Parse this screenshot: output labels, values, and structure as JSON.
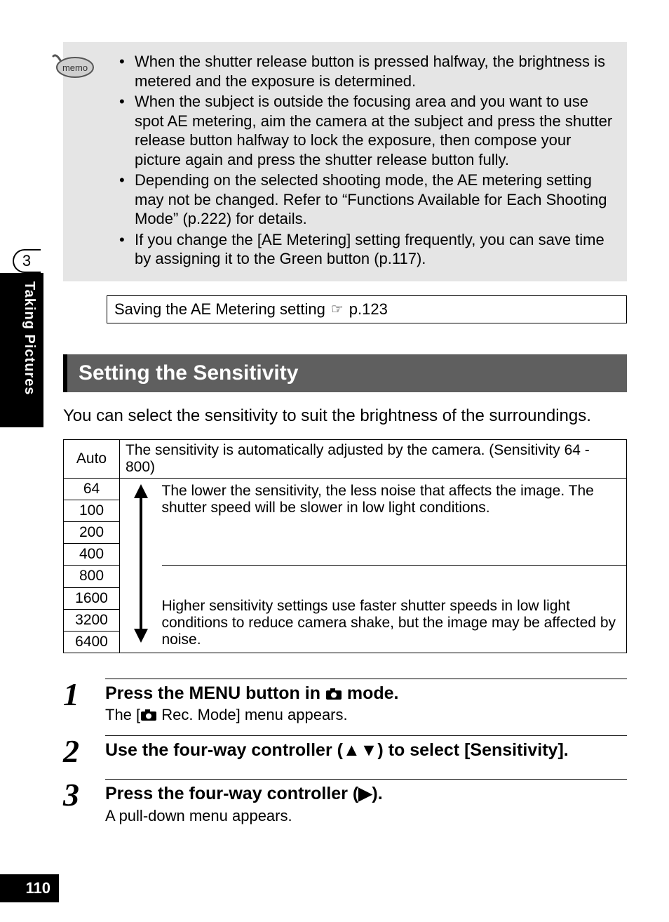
{
  "side_tab": {
    "chapter_number": "3",
    "chapter_title": "Taking Pictures"
  },
  "memo": {
    "label": "memo",
    "bullets": [
      "When the shutter release button is pressed halfway, the brightness is metered and the exposure is determined.",
      "When the subject is outside the focusing area and you want to use spot AE metering, aim the camera at the subject and press the shutter release button halfway to lock the exposure, then compose your picture again and press the shutter release button fully.",
      "Depending on the selected shooting mode, the AE metering setting may not be changed. Refer to “Functions Available for Each Shooting Mode” (p.222) for details.",
      "If you change the [AE Metering] setting frequently, you can save time by assigning it to the Green button (p.117)."
    ]
  },
  "link_box": {
    "text": "Saving the AE Metering setting",
    "page_ref": "p.123"
  },
  "section": {
    "heading": "Setting the Sensitivity",
    "intro": "You can select the sensitivity to suit the brightness of the surroundings."
  },
  "sensitivity_table": {
    "rows": [
      {
        "label": "Auto",
        "desc": "The sensitivity is automatically adjusted by the camera. (Sensitivity 64 - 800)"
      },
      {
        "label": "64"
      },
      {
        "label": "100"
      },
      {
        "label": "200"
      },
      {
        "label": "400"
      },
      {
        "label": "800"
      },
      {
        "label": "1600"
      },
      {
        "label": "3200"
      },
      {
        "label": "6400"
      }
    ],
    "low_desc": "The lower the sensitivity, the less noise that affects the image. The shutter speed will be slower in low light conditions.",
    "high_desc": "Higher sensitivity settings use faster shutter speeds in low light conditions to reduce camera shake, but the image may be affected by noise."
  },
  "steps": [
    {
      "num": "1",
      "title_pre": "Press the ",
      "title_menu": "MENU",
      "title_mid": " button in ",
      "title_post": " mode.",
      "desc_pre": "The [",
      "desc_post": " Rec. Mode] menu appears."
    },
    {
      "num": "2",
      "title": "Use the four-way controller (▲▼) to select [Sensitivity]."
    },
    {
      "num": "3",
      "title": "Press the four-way controller (▶).",
      "desc": "A pull-down menu appears."
    }
  ],
  "page_number": "110"
}
